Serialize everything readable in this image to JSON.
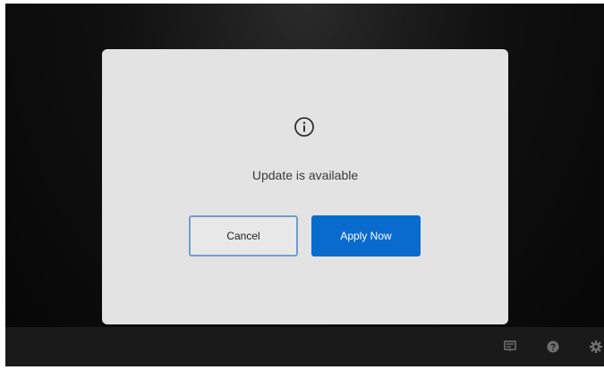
{
  "dialog": {
    "icon": "info-icon",
    "message": "Update is available",
    "cancel_label": "Cancel",
    "apply_label": "Apply Now"
  },
  "taskbar": {
    "icons": [
      "notification-tray-icon",
      "help-icon",
      "settings-icon"
    ]
  },
  "colors": {
    "accent": "#0a6bce",
    "dialog_bg": "#e3e3e3",
    "screen_bg": "#0a0a0a",
    "taskbar_bg": "#1a1a1a",
    "cancel_border": "#6f9fcf"
  }
}
